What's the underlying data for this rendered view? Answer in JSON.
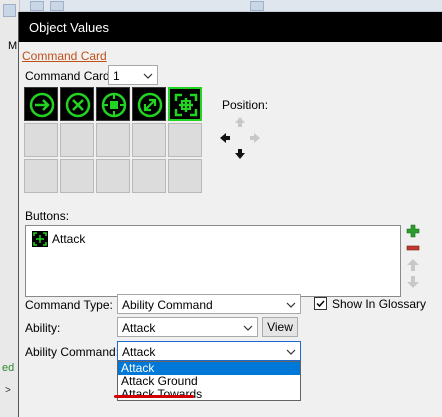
{
  "background_app": {
    "menu_fragment": "M",
    "status_fragment": "ed",
    "scroll_fragment": ">"
  },
  "dialog": {
    "title": "Object Values"
  },
  "command_card": {
    "link_label": "Command Card",
    "selector_label": "Command Card:",
    "selector_value": "1",
    "slots": [
      {
        "icon": "move-arrow-icon",
        "filled": true,
        "selected": false
      },
      {
        "icon": "stop-x-icon",
        "filled": true,
        "selected": false
      },
      {
        "icon": "hold-position-icon",
        "filled": true,
        "selected": false
      },
      {
        "icon": "patrol-arrows-icon",
        "filled": true,
        "selected": false
      },
      {
        "icon": "attack-crosshair-icon",
        "filled": true,
        "selected": true
      }
    ],
    "position_label": "Position:"
  },
  "buttons": {
    "label": "Buttons:",
    "items": [
      {
        "label": "Attack",
        "icon": "attack-crosshair-icon"
      }
    ]
  },
  "fields": {
    "command_type_label": "Command Type:",
    "command_type_value": "Ability Command",
    "show_in_glossary_label": "Show In Glossary",
    "show_in_glossary_checked": true,
    "ability_label": "Ability:",
    "ability_value": "Attack",
    "view_button": "View",
    "ability_command_label": "Ability Command:",
    "ability_command_value": "Attack"
  },
  "dropdown": {
    "options": [
      "Attack",
      "Attack Ground",
      "Attack Towards"
    ],
    "highlighted_index": 0,
    "underlined_index": 1
  },
  "colors": {
    "accent_green": "#22d322",
    "selection_blue": "#0078d7",
    "link_orange": "#c0501a",
    "annotation_red": "#d20000"
  }
}
